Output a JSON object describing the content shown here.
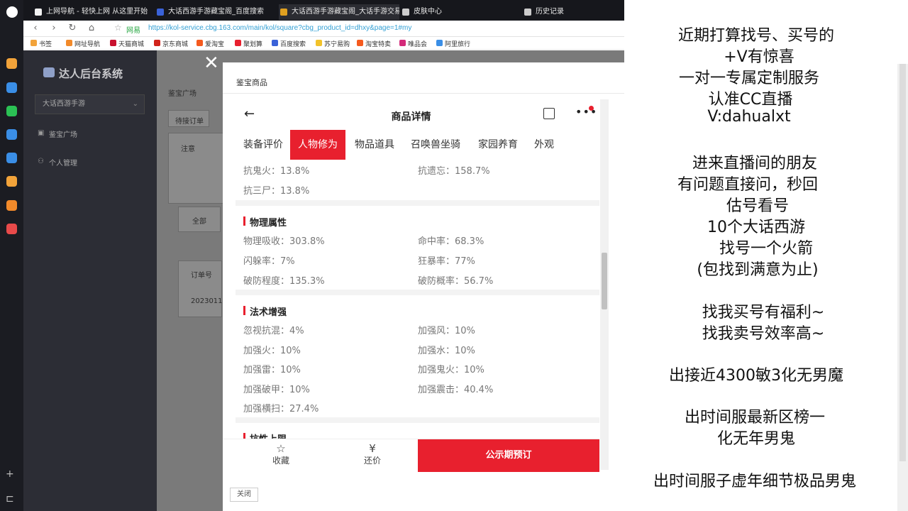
{
  "browser": {
    "tabs": [
      {
        "label": "上网导航 - 轻快上网 从这里开始",
        "color": "#f2f2f2"
      },
      {
        "label": "大话西游手游藏宝阁_百度搜索",
        "color": "#3a62d8"
      },
      {
        "label": "大话西游手游藏宝阁_大话手游交易",
        "color": "#e0a020"
      },
      {
        "label": "皮肤中心",
        "color": "#cccccc"
      },
      {
        "label": "历史记录",
        "color": "#cccccc"
      }
    ],
    "url_site": "网易",
    "url": "https://kol-service.cbg.163.com/main/kol/square?cbg_product_id=dhxy&page=1#my",
    "bookmarks": [
      "书签",
      "网址导航",
      "天猫商城",
      "京东商城",
      "爱淘宝",
      "聚划算",
      "百度搜索",
      "苏宁易购",
      "淘宝特卖",
      "唯品会",
      "阿里旅行"
    ]
  },
  "sidebar": {
    "title": "达人后台系统",
    "select_value": "大话西游手游",
    "items": [
      "鉴宝广场",
      "个人管理"
    ]
  },
  "behind": {
    "tab_left": "鉴宝广场",
    "label_pending": "待接订单",
    "note": "注意",
    "all_btn": "全部",
    "order_col": "订单号",
    "order_no": "2023011"
  },
  "modal": {
    "header": "鉴宝商品",
    "close_label": "关闭",
    "phone": {
      "title": "商品详情",
      "tabs": [
        "装备评价",
        "人物修为",
        "物品道具",
        "召唤兽坐骑",
        "家园养育",
        "外观"
      ],
      "active_tab": "人物修为",
      "top_rows": [
        {
          "left": "抗鬼火：13.8%",
          "right": "抗遗忘：158.7%"
        },
        {
          "left": "抗三尸：13.8%",
          "right": ""
        }
      ],
      "sections": [
        {
          "title": "物理属性",
          "rows": [
            {
              "left": "物理吸收：303.8%",
              "right": "命中率：68.3%"
            },
            {
              "left": "闪躲率：7%",
              "right": "狂暴率：77%"
            },
            {
              "left": "破防程度：135.3%",
              "right": "破防概率：56.7%"
            }
          ]
        },
        {
          "title": "法术增强",
          "rows": [
            {
              "left": "忽视抗混：4%",
              "right": "加强风：10%"
            },
            {
              "left": "加强火：10%",
              "right": "加强水：10%"
            },
            {
              "left": "加强雷：10%",
              "right": "加强鬼火：10%"
            },
            {
              "left": "加强破甲：10%",
              "right": "加强震击：40.4%"
            },
            {
              "left": "加强横扫：27.4%",
              "right": ""
            }
          ]
        },
        {
          "title": "抗性上限",
          "rows": []
        }
      ],
      "bottom": {
        "favorite": "收藏",
        "bargain": "还价",
        "reserve": "公示期预订"
      }
    }
  },
  "overlay_lines": [
    "近期打算找号、买号的",
    "+V有惊喜",
    "一对一专属定制服务",
    "认准CC直播",
    "V:dahualxt",
    "",
    "进来直播间的朋友",
    "有问题直接问，秒回",
    "估号看号",
    "10个大话西游",
    "找号一个火箭",
    "(包找到满意为止)",
    "",
    "找我买号有福利~",
    "找我卖号效率高~",
    "",
    "出接近4300敏3化无男魔",
    "",
    "出时间服最新区榜一",
    "化无年男鬼",
    "",
    "出时间服子虚年细节极品男鬼"
  ],
  "accent": "#e8202e"
}
